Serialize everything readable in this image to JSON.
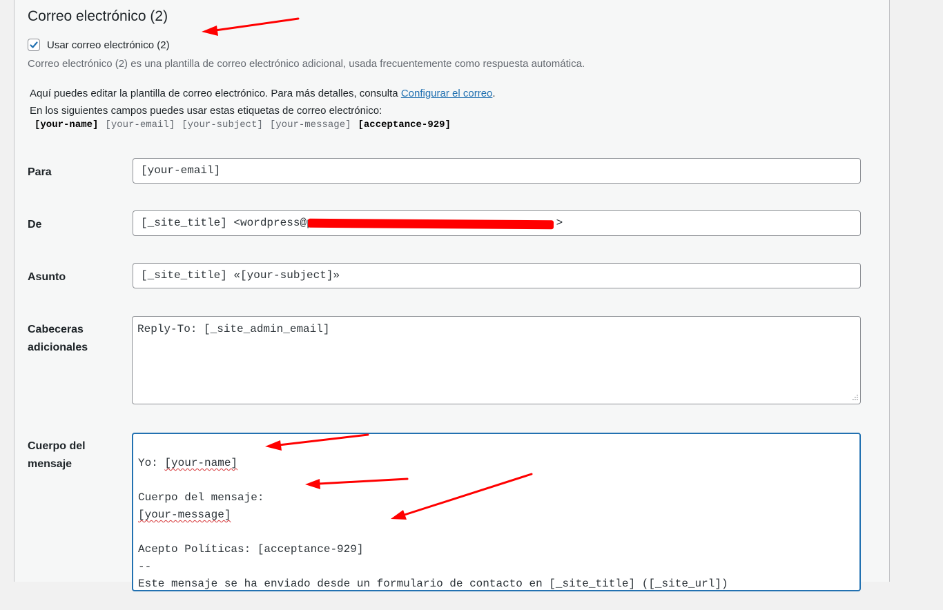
{
  "section": {
    "title": "Correo electrónico (2)",
    "checkbox_label": "Usar correo electrónico (2)",
    "checkbox_checked": true,
    "description": "Correo electrónico (2) es una plantilla de correo electrónico adicional, usada frecuentemente como respuesta automática."
  },
  "help": {
    "line1_prefix": "Aquí puedes editar la plantilla de correo electrónico. Para más detalles, consulta ",
    "line1_link": "Configurar el correo",
    "line1_suffix": ".",
    "line2": "En los siguientes campos puedes usar estas etiquetas de correo electrónico:",
    "tags": [
      {
        "text": "[your-name]",
        "style": "bold"
      },
      {
        "text": "[your-email]",
        "style": "muted"
      },
      {
        "text": "[your-subject]",
        "style": "muted"
      },
      {
        "text": "[your-message]",
        "style": "muted"
      },
      {
        "text": "[acceptance-929]",
        "style": "bold"
      }
    ]
  },
  "fields": {
    "to": {
      "label": "Para",
      "value": "[your-email]"
    },
    "from": {
      "label": "De",
      "value_prefix": "[_site_title] <wordpress@p",
      "value_suffix": ">"
    },
    "subject": {
      "label": "Asunto",
      "value": "[_site_title] «[your-subject]»"
    },
    "headers": {
      "label_line1": "Cabeceras",
      "label_line2": "adicionales",
      "value": "Reply-To: [_site_admin_email]"
    },
    "body": {
      "label_line1": "Cuerpo del",
      "label_line2": "mensaje",
      "lines": [
        {
          "prefix": "Yo: ",
          "tag": "[your-name]"
        },
        {
          "prefix": "",
          "tag": ""
        },
        {
          "prefix": "Cuerpo del mensaje:",
          "tag": ""
        },
        {
          "prefix": "",
          "tag": "[your-message]"
        },
        {
          "prefix": "",
          "tag": ""
        },
        {
          "prefix": "Acepto Políticas: [acceptance-929]",
          "tag": ""
        },
        {
          "prefix": "--",
          "tag": ""
        },
        {
          "prefix": "Este mensaje se ha enviado desde un formulario de contacto en [_site_title] ([_site_url])",
          "tag": ""
        }
      ]
    }
  },
  "colors": {
    "link": "#2271b1",
    "focus": "#2271b1",
    "annotation": "#ff0000"
  }
}
